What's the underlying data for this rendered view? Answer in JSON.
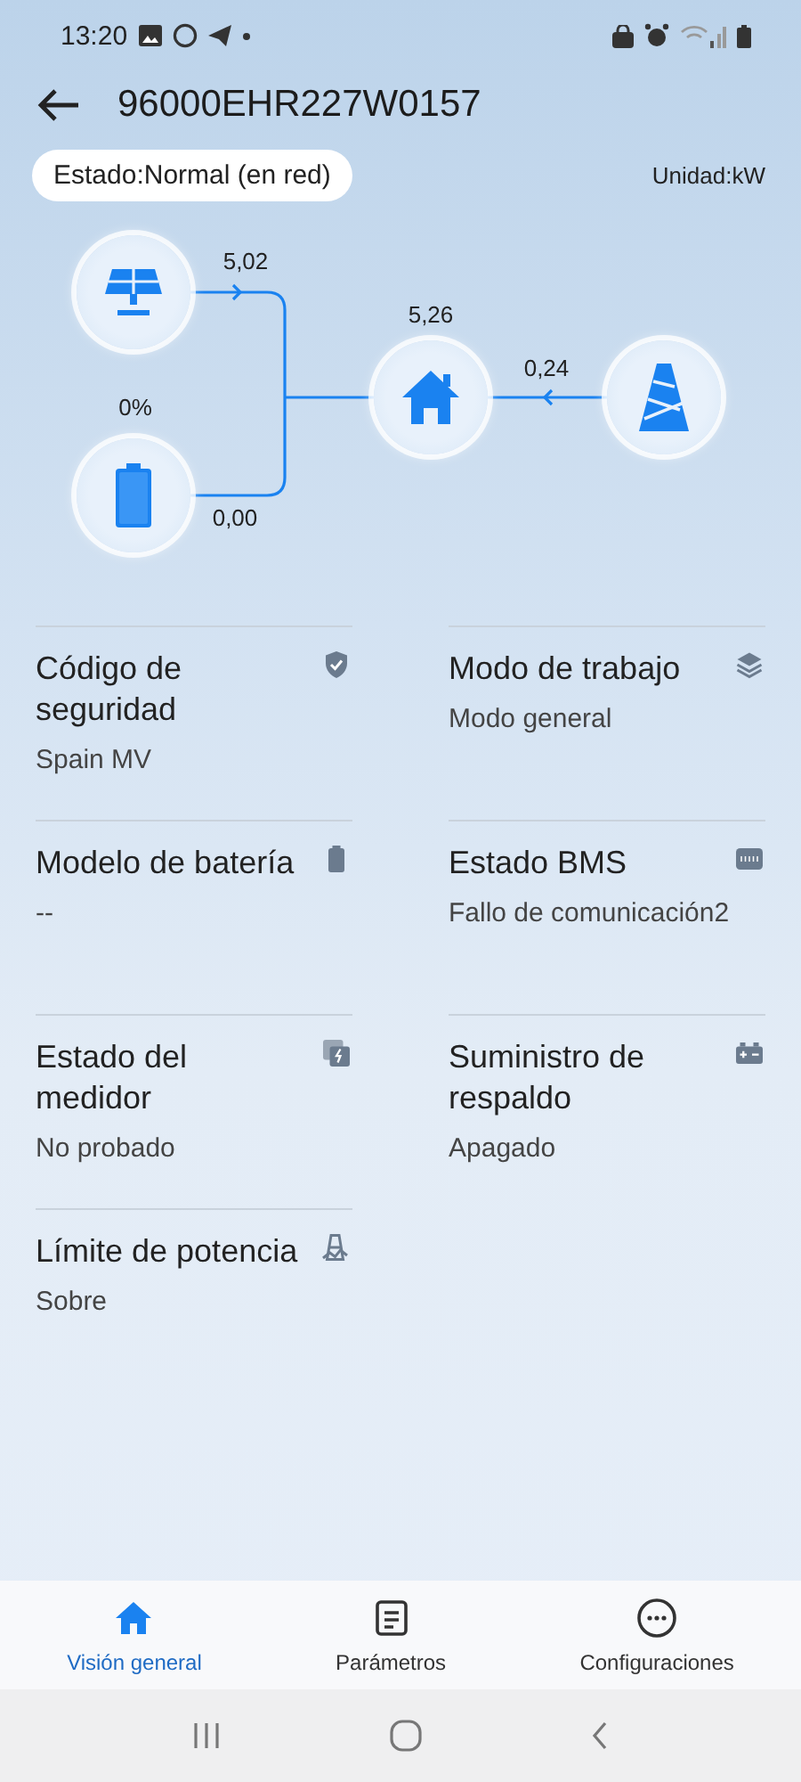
{
  "status_bar": {
    "time": "13:20"
  },
  "header": {
    "title": "96000EHR227W0157"
  },
  "status_pill": {
    "text": "Estado:Normal (en red)"
  },
  "unit": {
    "text": "Unidad:kW"
  },
  "flow": {
    "solar_power": "5,02",
    "battery_percent": "0%",
    "battery_power": "0,00",
    "home_power": "5,26",
    "grid_power": "0,24"
  },
  "info_items": [
    {
      "kind": "shield",
      "label": "Código de seguridad",
      "value": "Spain MV"
    },
    {
      "kind": "layers",
      "label": "Modo de trabajo",
      "value": "Modo general"
    },
    {
      "kind": "battery",
      "label": "Modelo de batería",
      "value": "--"
    },
    {
      "kind": "bms",
      "label": "Estado BMS",
      "value": "Fallo de comunicación2"
    },
    {
      "kind": "meter",
      "label": "Estado del medidor",
      "value": "No probado"
    },
    {
      "kind": "backup",
      "label": "Suministro de respaldo",
      "value": "Apagado"
    },
    {
      "kind": "limit",
      "label": "Límite de potencia",
      "value": "Sobre"
    }
  ],
  "nav_tabs": [
    {
      "kind": "home",
      "label": "Visión general",
      "selected": true
    },
    {
      "kind": "doc",
      "label": "Parámetros",
      "selected": false
    },
    {
      "kind": "more",
      "label": "Configuraciones",
      "selected": false
    }
  ]
}
